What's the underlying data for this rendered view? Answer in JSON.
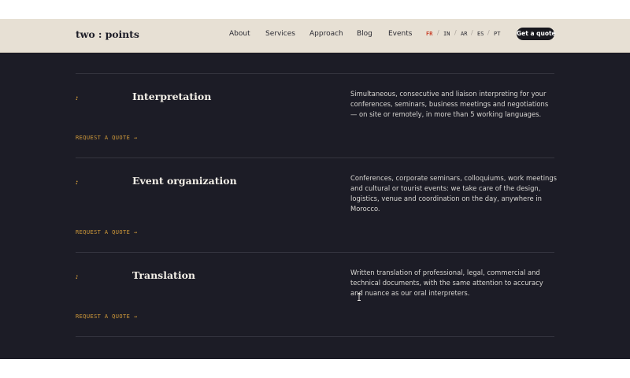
{
  "header": {
    "logo": {
      "left": "two",
      "colon": ":",
      "right": "points"
    },
    "nav": [
      "About",
      "Services",
      "Approach",
      "Blog",
      "Events"
    ],
    "languages": [
      "FR",
      "IN",
      "AR",
      "ES",
      "PT"
    ],
    "language_separator": "/",
    "active_language": "FR",
    "cta_label": "Get a quote"
  },
  "services": [
    {
      "marker": ":",
      "title": "Interpretation",
      "description": "Simultaneous, consecutive and liaison interpreting for your conferences, seminars, business meetings and negotiations — on site or remotely, in more than 5 working languages.",
      "link": "REQUEST A QUOTE →"
    },
    {
      "marker": ":",
      "title": "Event organization",
      "description": "Conferences, corporate seminars, colloquiums, work meetings and cultural or tourist events: we take care of the design, logistics, venue and coordination on the day, anywhere in Morocco.",
      "link": "REQUEST A QUOTE →"
    },
    {
      "marker": ":",
      "title": "Translation",
      "description": "Written translation of professional, legal, commercial and technical documents, with the same attention to accuracy and nuance as our oral interpreters.",
      "link": "REQUEST A QUOTE →"
    }
  ],
  "colors": {
    "header_bg": "#e7e0d4",
    "section_bg": "#1c1c26",
    "accent": "#d19a3a",
    "active_lang": "#c9432d"
  },
  "icons": {
    "cursor": "text-cursor-icon"
  }
}
